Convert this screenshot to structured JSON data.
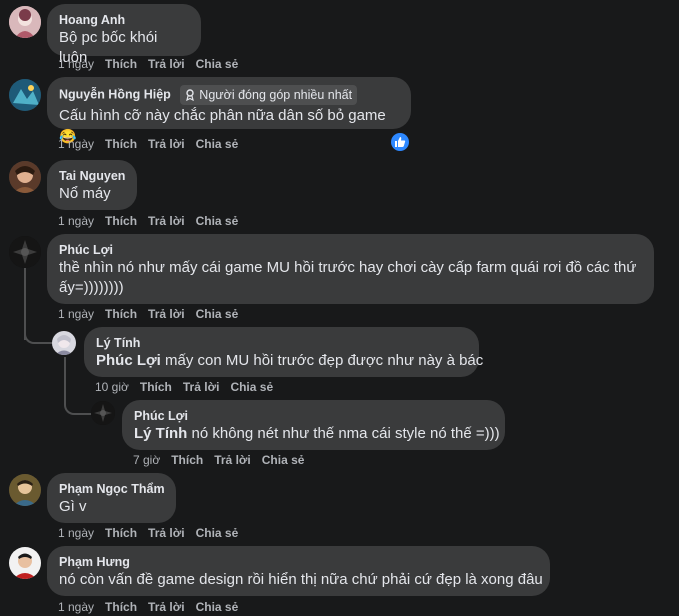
{
  "comments": [
    {
      "name": "Hoang Anh",
      "text": "Bộ pc bốc khói luôn",
      "time": "1 ngày",
      "like": "Thích",
      "reply": "Trả lời",
      "share": "Chia sẻ"
    },
    {
      "name": "Nguyễn Hồng Hiệp",
      "badge": "Người đóng góp nhiều nhất",
      "text": "Cấu hình cỡ này chắc phân nữa dân số bỏ game",
      "emoji": "😂",
      "time": "1 ngày",
      "like": "Thích",
      "reply": "Trả lời",
      "share": "Chia sẻ"
    },
    {
      "name": "Tai Nguyen",
      "text": "Nổ máy",
      "time": "1 ngày",
      "like": "Thích",
      "reply": "Trả lời",
      "share": "Chia sẻ"
    },
    {
      "name": "Phúc Lợi",
      "text_line1": "thề nhìn nó như mấy cái game MU hồi trước hay chơi cày cấp farm quái rơi đồ các thứ",
      "text_line2": "ấy=))))))))",
      "time": "1 ngày",
      "like": "Thích",
      "reply": "Trả lời",
      "share": "Chia sẻ"
    },
    {
      "name": "Lý Tính",
      "mention": "Phúc Lợi",
      "text": " mấy con MU hồi trước đẹp được như này à bác",
      "time": "10 giờ",
      "like": "Thích",
      "reply": "Trả lời",
      "share": "Chia sẻ"
    },
    {
      "name": "Phúc Lợi",
      "mention": "Lý Tính",
      "text": " nó không nét như thế nma cái style nó thế =)))",
      "time": "7 giờ",
      "like": "Thích",
      "reply": "Trả lời",
      "share": "Chia sẻ"
    },
    {
      "name": "Phạm Ngọc Thẩm",
      "text": "Gì v",
      "time": "1 ngày",
      "like": "Thích",
      "reply": "Trả lời",
      "share": "Chia sẻ"
    },
    {
      "name": "Phạm Hưng",
      "text": "nó còn vấn đề game design rồi hiển thị nữa chứ phải cứ đẹp là xong đâu",
      "time": "1 ngày",
      "like": "Thích",
      "reply": "Trả lời",
      "share": "Chia sẻ"
    }
  ],
  "colors": {
    "background": "#18191a",
    "bubble": "#3a3b3c",
    "text": "#e4e6eb",
    "muted": "#b0b3b8",
    "reaction": "#2d88ff"
  },
  "icons": {
    "badge": "contributor-badge-icon",
    "reaction": "like-reaction-icon"
  }
}
